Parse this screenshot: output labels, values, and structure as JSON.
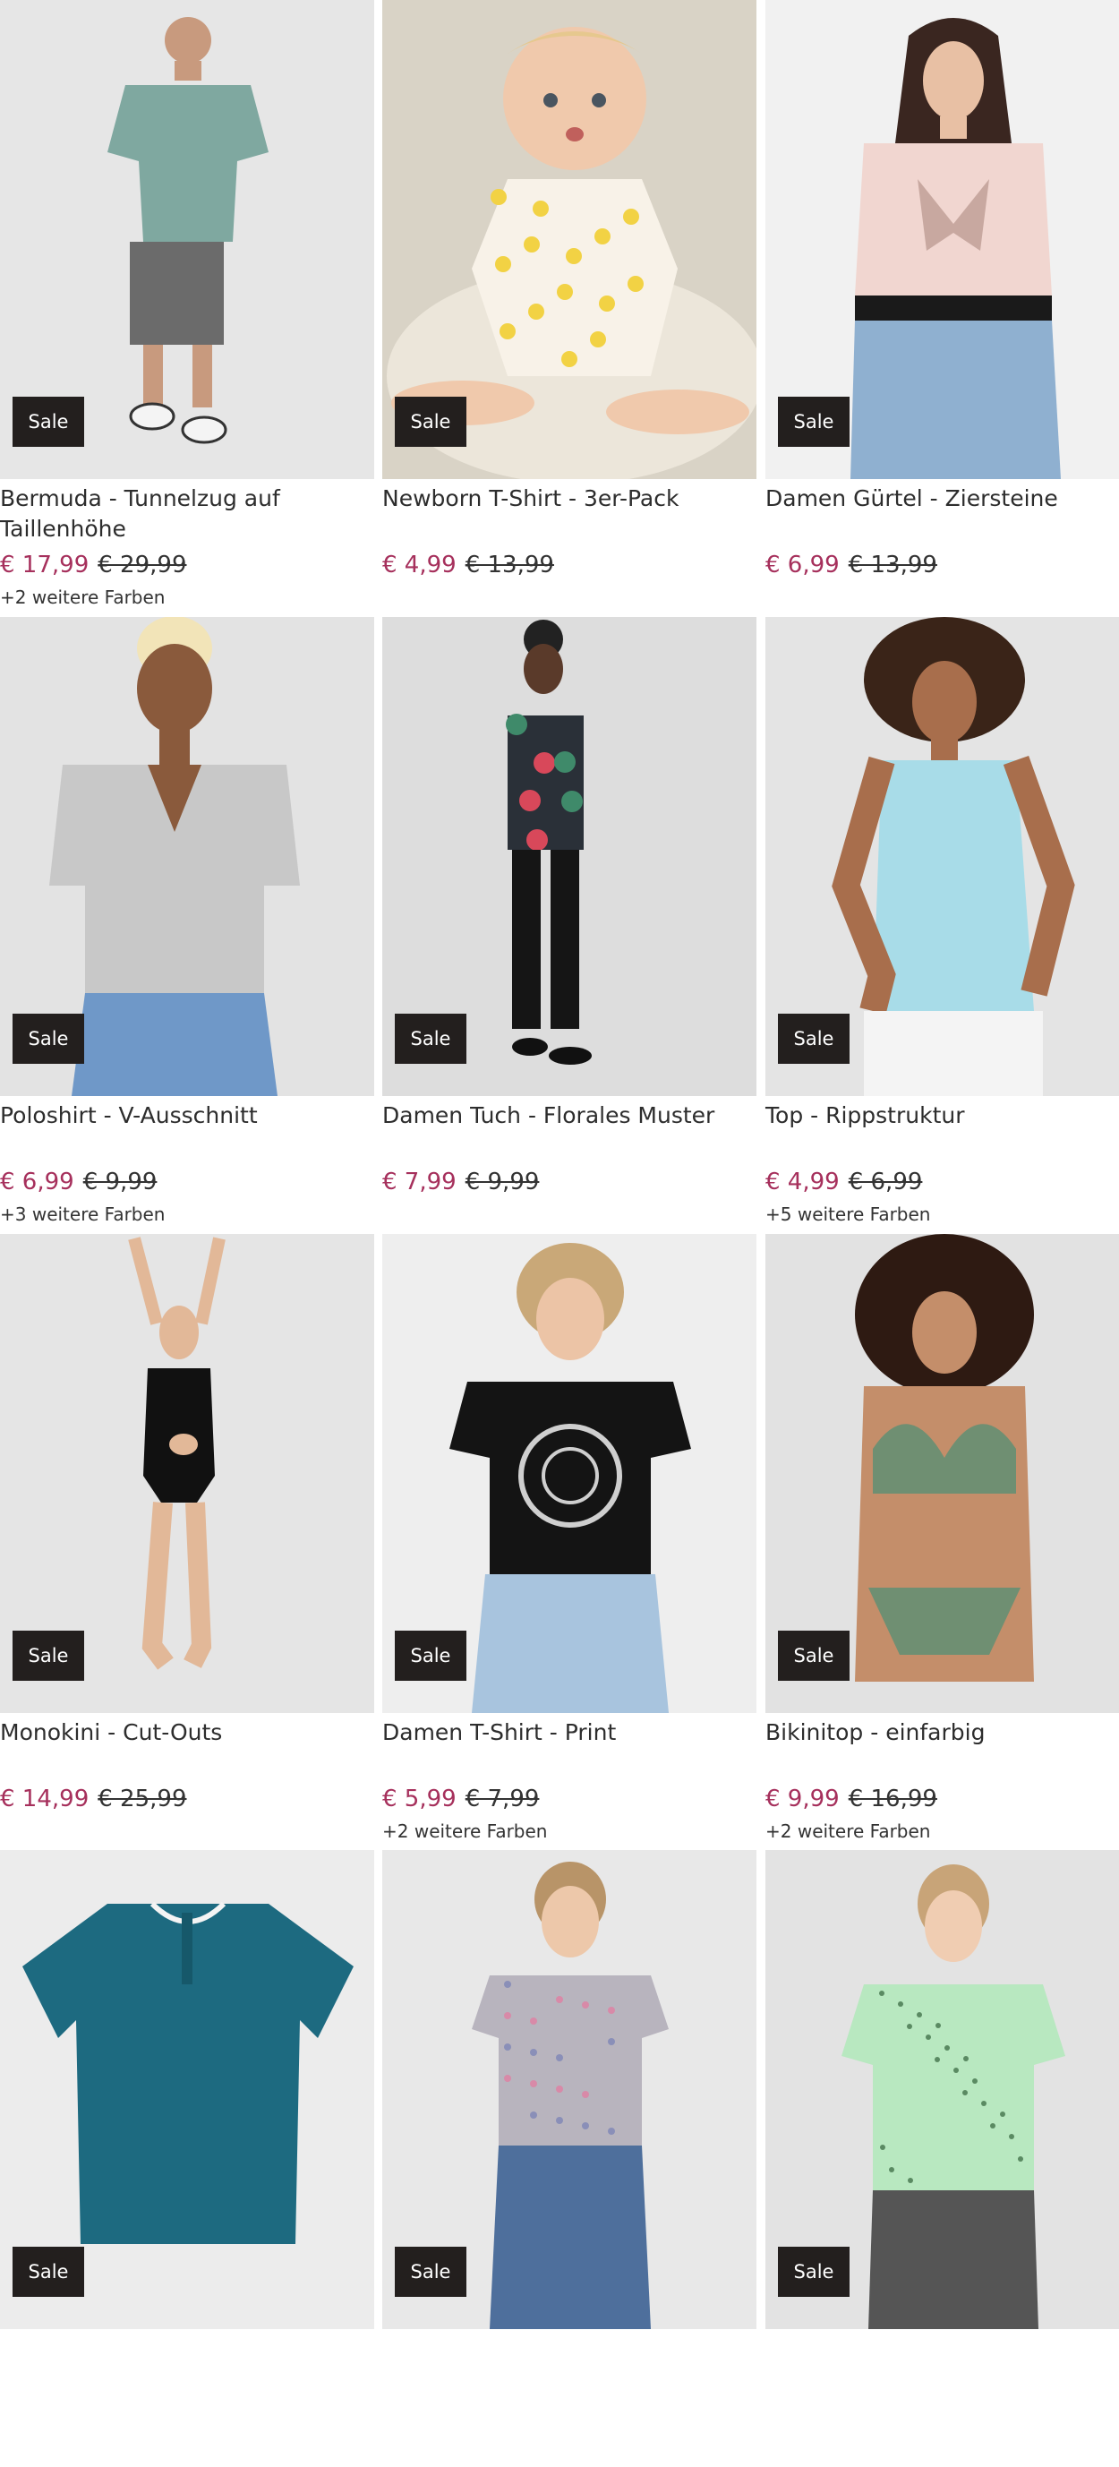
{
  "products": [
    {
      "title": "Bermuda - Tunnelzug auf Taillenhöhe",
      "price": "€ 17,99",
      "old_price": "€ 29,99",
      "badge": "Sale",
      "colors": "+2 weitere Farben",
      "photo_bg": "#e6e6e6",
      "photo_subject": "man-tshirt-shorts"
    },
    {
      "title": "Newborn T-Shirt - 3er-Pack",
      "price": "€ 4,99",
      "old_price": "€ 13,99",
      "badge": "Sale",
      "colors": "",
      "photo_bg": "#d9d3c6",
      "photo_subject": "baby-tshirt"
    },
    {
      "title": "Damen Gürtel - Ziersteine",
      "price": "€ 6,99",
      "old_price": "€ 13,99",
      "badge": "Sale",
      "colors": "",
      "photo_bg": "#f1f1f1",
      "photo_subject": "woman-pink-shirt-belt"
    },
    {
      "title": "Poloshirt - V-Ausschnitt",
      "price": "€ 6,99",
      "old_price": "€ 9,99",
      "badge": "Sale",
      "colors": "+3 weitere Farben",
      "photo_bg": "#e3e3e3",
      "photo_subject": "woman-grey-polo"
    },
    {
      "title": "Damen Tuch - Florales Muster",
      "price": "€ 7,99",
      "old_price": "€ 9,99",
      "badge": "Sale",
      "colors": "",
      "photo_bg": "#dddddd",
      "photo_subject": "woman-floral-scarf"
    },
    {
      "title": "Top - Rippstruktur",
      "price": "€ 4,99",
      "old_price": "€ 6,99",
      "badge": "Sale",
      "colors": "+5 weitere Farben",
      "photo_bg": "#e4e4e4",
      "photo_subject": "woman-blue-tank"
    },
    {
      "title": "Monokini - Cut-Outs",
      "price": "€ 14,99",
      "old_price": "€ 25,99",
      "badge": "Sale",
      "colors": "",
      "photo_bg": "#e5e5e5",
      "photo_subject": "woman-black-monokini"
    },
    {
      "title": "Damen T-Shirt - Print",
      "price": "€ 5,99",
      "old_price": "€ 7,99",
      "badge": "Sale",
      "colors": "+2 weitere Farben",
      "photo_bg": "#eeeeee",
      "photo_subject": "woman-black-print-tee"
    },
    {
      "title": "Bikinitop - einfarbig",
      "price": "€ 9,99",
      "old_price": "€ 16,99",
      "badge": "Sale",
      "colors": "+2 weitere Farben",
      "photo_bg": "#e2e2e2",
      "photo_subject": "woman-green-bikini"
    },
    {
      "title": "",
      "price": "",
      "old_price": "",
      "badge": "Sale",
      "colors": "",
      "photo_bg": "#ececec",
      "photo_subject": "teal-henley-tshirt"
    },
    {
      "title": "",
      "price": "",
      "old_price": "",
      "badge": "Sale",
      "colors": "",
      "photo_bg": "#e8e8e8",
      "photo_subject": "woman-floral-grey-tee"
    },
    {
      "title": "",
      "price": "",
      "old_price": "",
      "badge": "Sale",
      "colors": "",
      "photo_bg": "#e3e3e3",
      "photo_subject": "woman-mint-tee"
    }
  ],
  "colors": {
    "sale_price": "#a6305c",
    "badge_bg": "#231f1e",
    "text": "#2d2d2d"
  }
}
